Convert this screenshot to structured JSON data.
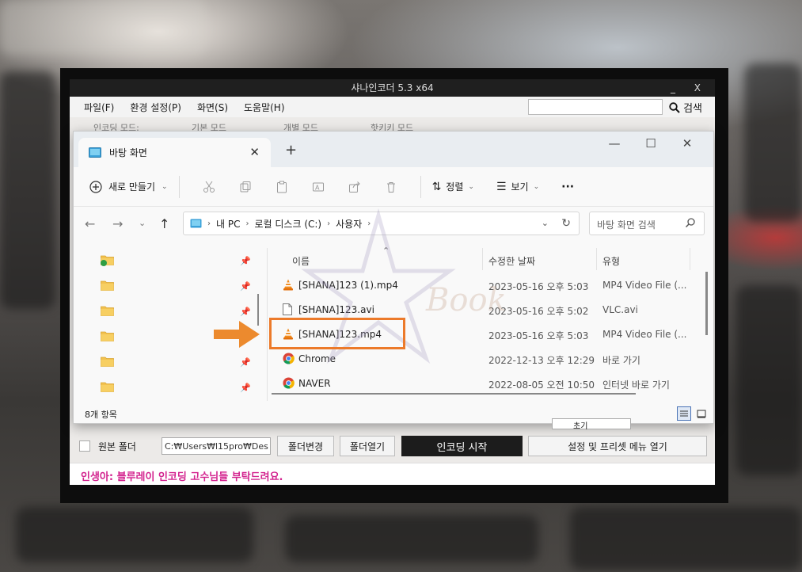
{
  "shana": {
    "title": "샤나인코더  5.3  x64",
    "window_controls": "_  X",
    "menu": [
      "파일(F)",
      "환경 설정(P)",
      "화면(S)",
      "도움말(H)"
    ],
    "search_label": "검색",
    "hidden_row": [
      "인코딩 모드:",
      "기본 모드",
      "개별 모드",
      "핫키키 모드"
    ],
    "source_folder_label": "원본 폴더",
    "path_value": "C:₩Users₩l15pro₩Des",
    "buttons": {
      "change_folder": "폴더변경",
      "open_folder": "폴더열기",
      "start_encoding": "인코딩 시작",
      "settings_presets": "설정 및 프리셋 메뉴 열기"
    },
    "notice": "인생아: 블루레이 인코딩 고수님들 부탁드려요."
  },
  "explorer": {
    "tab_title": "바탕 화면",
    "toolbar": {
      "new_label": "새로 만들기",
      "sort_label": "정렬",
      "view_label": "보기",
      "more_label": "···"
    },
    "breadcrumb": [
      "내 PC",
      "로컬 디스크 (C:)",
      "사용자"
    ],
    "search_placeholder": "바탕 화면 검색",
    "columns": {
      "name": "이름",
      "date": "수정한 날짜",
      "type": "유형"
    },
    "files": [
      {
        "name": "[SHANA]123 (1).mp4",
        "date": "2023-05-16 오후 5:03",
        "type": "MP4 Video File (...",
        "icon": "vlc-icon"
      },
      {
        "name": "[SHANA]123.avi",
        "date": "2023-05-16 오후 5:02",
        "type": "VLC.avi",
        "icon": "file-icon"
      },
      {
        "name": "[SHANA]123.mp4",
        "date": "2023-05-16 오후 5:03",
        "type": "MP4 Video File (...",
        "icon": "vlc-icon"
      },
      {
        "name": "Chrome",
        "date": "2022-12-13 오후 12:29",
        "type": "바로 가기",
        "icon": "chrome-icon"
      },
      {
        "name": "NAVER",
        "date": "2022-08-05 오전 10:50",
        "type": "인터넷 바로 가기",
        "icon": "chrome-icon"
      }
    ],
    "status_count": "8개 항목"
  },
  "colors": {
    "highlight": "#ec7a2a",
    "notice_text": "#d3248f",
    "folder": "#f2c14e"
  }
}
